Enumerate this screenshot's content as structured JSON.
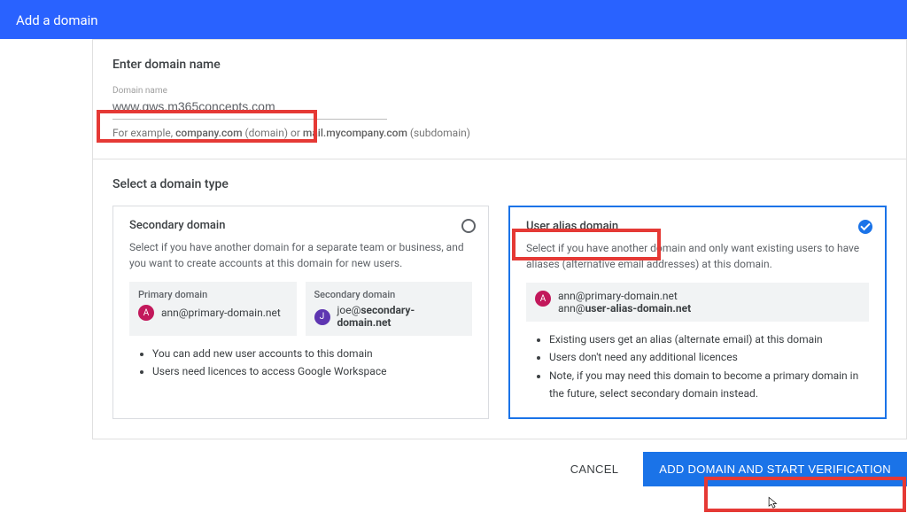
{
  "header": {
    "title": "Add a domain"
  },
  "enter": {
    "section_title": "Enter domain name",
    "input_label": "Domain name",
    "value": "www.gws.m365concepts.com",
    "helper_prefix": "For example, ",
    "helper_domain": "company.com",
    "helper_mid1": " (domain) or ",
    "helper_sub": "mail.mycompany.com",
    "helper_mid2": " (subdomain)"
  },
  "select": {
    "section_title": "Select a domain type",
    "secondary": {
      "title": "Secondary domain",
      "desc": "Select if you have another domain for a separate team or business, and you want to create accounts at this domain for new users.",
      "primary_label": "Primary domain",
      "primary_email": "ann@primary-domain.net",
      "secondary_label": "Secondary domain",
      "secondary_email_user": "joe@",
      "secondary_email_host": "secondary-domain.net",
      "bullets": [
        "You can add new user accounts to this domain",
        "Users need licences to access Google Workspace"
      ]
    },
    "alias": {
      "title": "User alias domain",
      "desc": "Select if you have another domain and only want existing users to have aliases (alternative email addresses) at this domain.",
      "email1": "ann@primary-domain.net",
      "email2_user": "ann@",
      "email2_host": "user-alias-domain.net",
      "bullets": [
        "Existing users get an alias (alternate email) at this domain",
        "Users don't need any additional licences",
        "Note, if you may need this domain to become a primary domain in the future, select secondary domain instead."
      ]
    }
  },
  "footer": {
    "cancel": "CANCEL",
    "submit": "ADD DOMAIN AND START VERIFICATION"
  }
}
